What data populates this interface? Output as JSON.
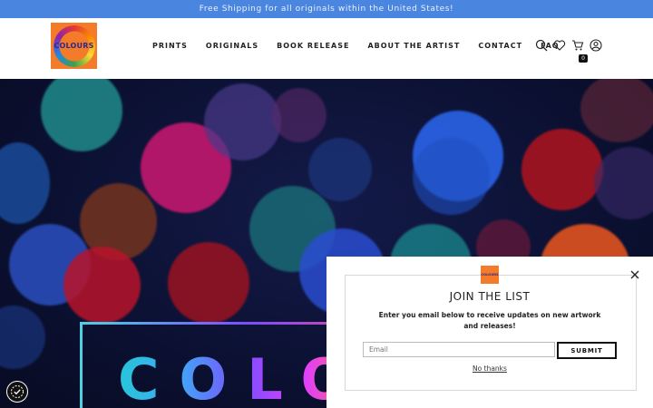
{
  "announcement": {
    "text": "Free Shipping for all originals within the United States!"
  },
  "header": {
    "logo_text": "COLOURS",
    "nav": [
      "PRINTS",
      "ORIGINALS",
      "BOOK RELEASE",
      "ABOUT THE ARTIST",
      "CONTACT",
      "FAQ"
    ],
    "icons": [
      "search-icon",
      "heart-icon",
      "cart-icon",
      "account-icon"
    ],
    "cart_count": "0"
  },
  "hero": {
    "title": "COLO"
  },
  "popup": {
    "logo_text": "COLOURS",
    "title": "JOIN THE LIST",
    "subtitle": "Enter you email below to receive updates on new artwork and releases!",
    "email_placeholder": "Email",
    "submit_label": "SUBMIT",
    "dismiss_label": "No thanks"
  },
  "colors": {
    "announcement_bg": "#4a86e0",
    "logo_bg": "#f47b2a",
    "hero_bg": "#0b1030"
  }
}
